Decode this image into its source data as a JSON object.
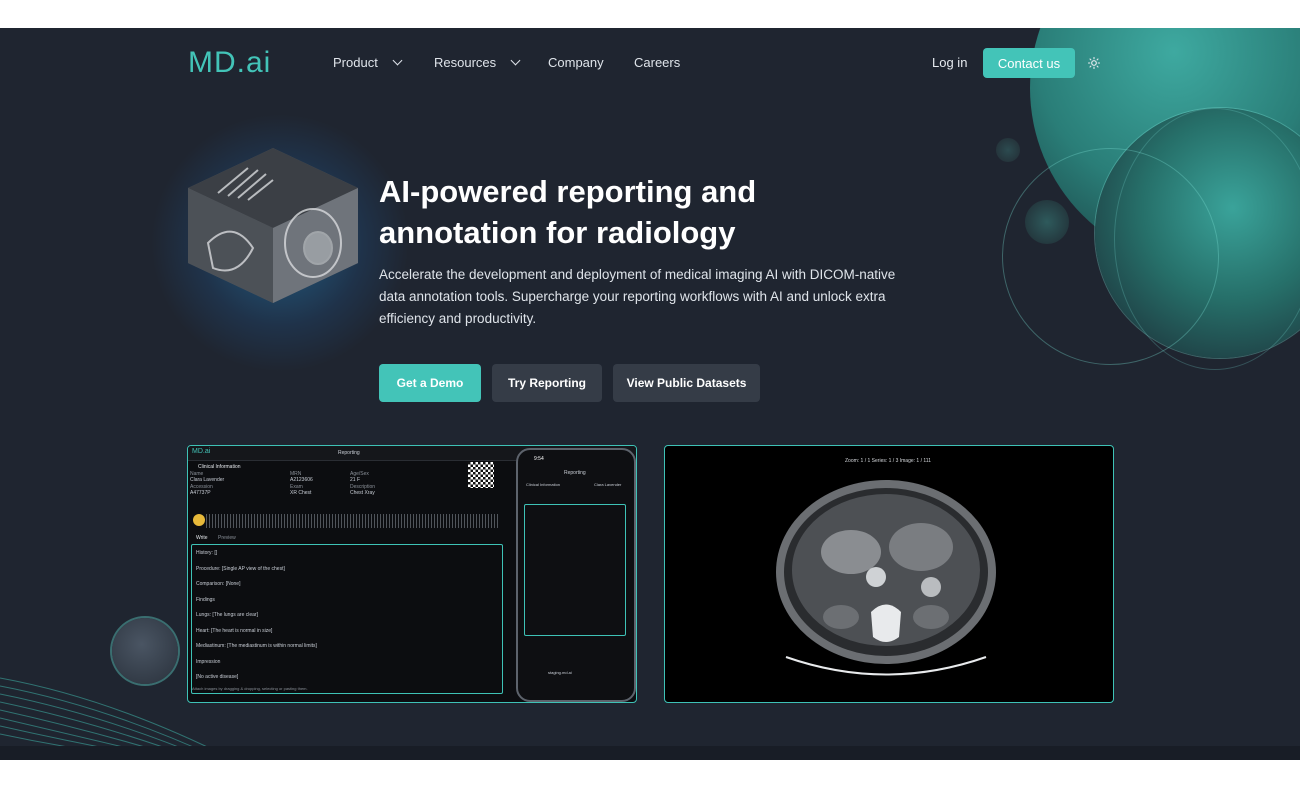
{
  "nav": {
    "logo": "MD.ai",
    "items": [
      {
        "label": "Product",
        "has_menu": true
      },
      {
        "label": "Resources",
        "has_menu": true
      },
      {
        "label": "Company",
        "has_menu": false
      },
      {
        "label": "Careers",
        "has_menu": false
      }
    ],
    "login": "Log in",
    "contact": "Contact us"
  },
  "hero": {
    "title_line1": "AI-powered reporting and",
    "title_line2": "annotation for radiology",
    "subtitle": "Accelerate the development and deployment of medical imaging AI with DICOM-native data annotation tools. Supercharge your reporting workflows with AI and unlock extra efficiency and productivity.",
    "buttons": {
      "demo": "Get a Demo",
      "try": "Try Reporting",
      "datasets": "View Public Datasets"
    }
  },
  "reporting_app": {
    "logo": "MD.ai",
    "title": "Reporting",
    "section": "Clinical Information",
    "fields": [
      {
        "label": "Name",
        "value": "Clara Lavender"
      },
      {
        "label": "MRN",
        "value": "A2123606"
      },
      {
        "label": "Age/Sex",
        "value": "21 F"
      },
      {
        "label": "Accession",
        "value": "A47737P"
      },
      {
        "label": "Exam",
        "value": "XR Chest"
      },
      {
        "label": "Description",
        "value": "Chest Xray"
      }
    ],
    "tabs": [
      "Write",
      "Preview"
    ],
    "lines": [
      "History: []",
      "Procedure: [Single AP view of the chest]",
      "Comparison: [None]",
      "Findings",
      "Lungs: [The lungs are clear]",
      "Heart: [The heart is normal in size]",
      "Mediastinum: [The mediastinum is within normal limits]",
      "Impression",
      "[No active disease]"
    ],
    "footer": "Attach images by dragging & dropping, selecting or pasting them."
  },
  "phone": {
    "time": "9:54",
    "title": "Reporting",
    "section": "Clinical Information",
    "patient": "Clara Lavender",
    "url": "staging.md.ai"
  },
  "ct_viewer": {
    "overlay": "Zoom: 1 / 1   Series: 1 / 3   Image: 1 / 111"
  },
  "colors": {
    "accent": "#43c4b8",
    "background": "#1f2530",
    "button_dark": "#353c47"
  }
}
